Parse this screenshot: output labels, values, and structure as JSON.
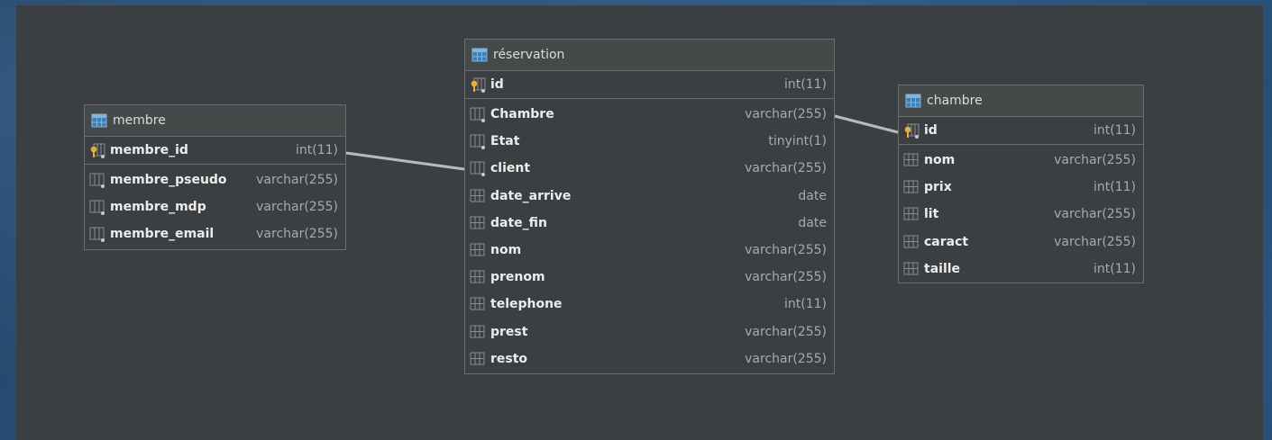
{
  "diagram": {
    "tables": {
      "membre": {
        "name": "membre",
        "pk": {
          "name": "membre_id",
          "type": "int(11)"
        },
        "columns": [
          {
            "name": "membre_pseudo",
            "type": "varchar(255)"
          },
          {
            "name": "membre_mdp",
            "type": "varchar(255)"
          },
          {
            "name": "membre_email",
            "type": "varchar(255)"
          }
        ]
      },
      "reservation": {
        "name": "réservation",
        "pk": {
          "name": "id",
          "type": "int(11)"
        },
        "columns": [
          {
            "name": "Chambre",
            "type": "varchar(255)"
          },
          {
            "name": "Etat",
            "type": "tinyint(1)"
          },
          {
            "name": "client",
            "type": "varchar(255)"
          },
          {
            "name": "date_arrive",
            "type": "date"
          },
          {
            "name": "date_fin",
            "type": "date"
          },
          {
            "name": "nom",
            "type": "varchar(255)"
          },
          {
            "name": "prenom",
            "type": "varchar(255)"
          },
          {
            "name": "telephone",
            "type": "int(11)"
          },
          {
            "name": "prest",
            "type": "varchar(255)"
          },
          {
            "name": "resto",
            "type": "varchar(255)"
          }
        ]
      },
      "chambre": {
        "name": "chambre",
        "pk": {
          "name": "id",
          "type": "int(11)"
        },
        "columns": [
          {
            "name": "nom",
            "type": "varchar(255)"
          },
          {
            "name": "prix",
            "type": "int(11)"
          },
          {
            "name": "lit",
            "type": "varchar(255)"
          },
          {
            "name": "caract",
            "type": "varchar(255)"
          },
          {
            "name": "taille",
            "type": "int(11)"
          }
        ]
      }
    },
    "relations": [
      {
        "from": "membre.membre_id",
        "to": "réservation.client"
      },
      {
        "from": "réservation.Chambre",
        "to": "chambre.id"
      }
    ],
    "icons": {
      "table": "table-icon",
      "key": "primary-key-icon",
      "column": "column-icon"
    },
    "colors": {
      "canvas": "#3c3f41",
      "border": "#6b6e70",
      "connector": "#b8bbbd",
      "key": "#e0b040"
    }
  }
}
